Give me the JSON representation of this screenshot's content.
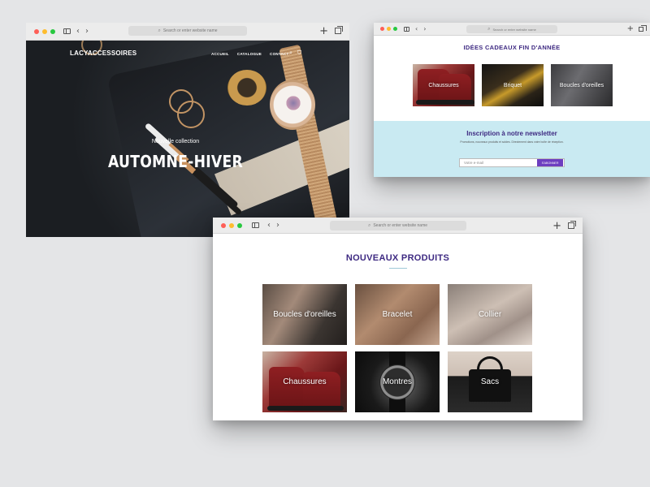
{
  "windows": {
    "hero": {
      "url_placeholder": "Search or enter website name",
      "logo": "LACYACCESSOIRES",
      "menu": [
        "ACCUEIL",
        "CATALOGUE",
        "CONTACT"
      ],
      "subtitle": "Nouvelle collection",
      "title": "AUTOMNE-HIVER"
    },
    "gifts": {
      "url_placeholder": "Search or enter website name",
      "title": "IDÉES CADEAUX FIN D'ANNÉE",
      "items": [
        "Chaussures",
        "Briquet",
        "Boucles d'oreilles"
      ],
      "newsletter": {
        "title": "Inscription à notre newsletter",
        "text": "Promotions, nouveaux produits et soldes. Directement dans votre boîte de réception.",
        "email_placeholder": "Votre e-mail",
        "button": "S'ABONNER"
      }
    },
    "products": {
      "url_placeholder": "Search or enter website name",
      "title": "NOUVEAUX PRODUITS",
      "items": [
        "Boucles d'oreilles",
        "Bracelet",
        "Collier",
        "Chaussures",
        "Montres",
        "Sacs"
      ]
    }
  },
  "icons": {
    "back": "chevron-left-icon",
    "forward": "chevron-right-icon",
    "new_tab": "plus-icon",
    "tabs": "tabs-overview-icon",
    "sidebar": "sidebar-icon",
    "search": "search-icon",
    "cart": "cart-icon"
  },
  "colors": {
    "brand_purple": "#3e2a82",
    "newsletter_bg": "#c9eaf2",
    "button_purple": "#6d3ec0",
    "page_bg": "#e4e5e7"
  }
}
